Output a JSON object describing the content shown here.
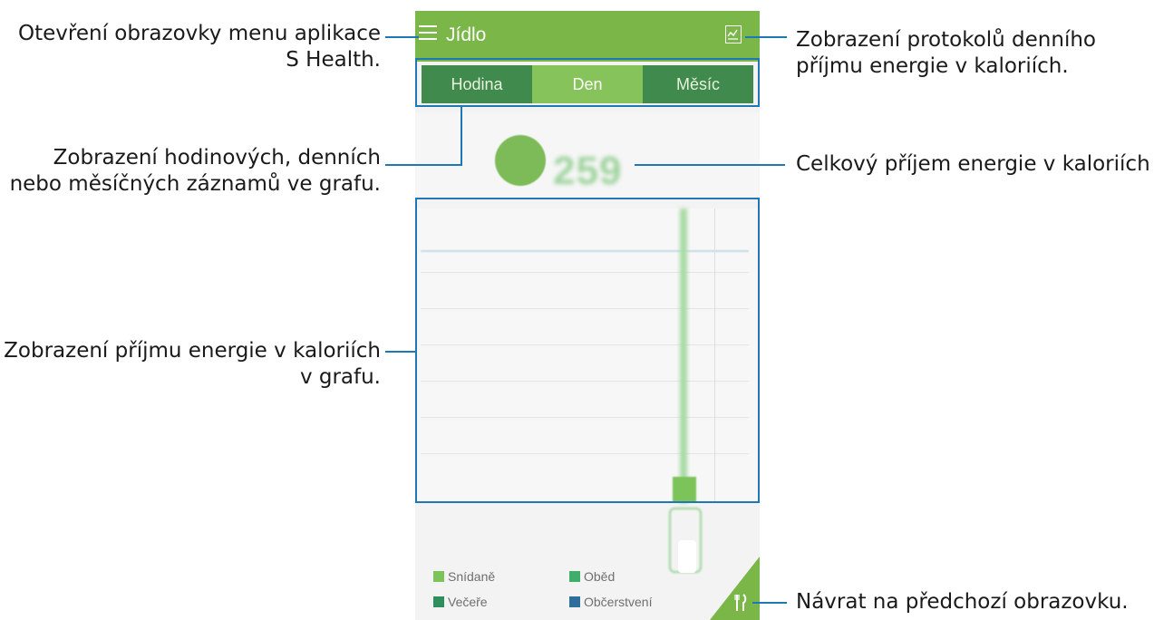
{
  "app": {
    "title": "Jídlo"
  },
  "tabs": [
    {
      "label": "Hodina",
      "selected": false
    },
    {
      "label": "Den",
      "selected": true
    },
    {
      "label": "Měsíc",
      "selected": false
    }
  ],
  "summary": {
    "kcal": "259"
  },
  "legend": [
    {
      "label": "Snídaně",
      "color": "#7cc45a"
    },
    {
      "label": "Oběd",
      "color": "#3fae6a"
    },
    {
      "label": "Večeře",
      "color": "#2e8f5c"
    },
    {
      "label": "Občerstvení",
      "color": "#2e6e9a"
    }
  ],
  "annotations": {
    "menu": [
      "Otevření obrazovky menu aplikace",
      "S Health."
    ],
    "logs": [
      "Zobrazení protokolů denního",
      "příjmu energie v kaloriích."
    ],
    "tabs": [
      "Zobrazení hodinových, denních",
      "nebo měsíčných záznamů ve grafu."
    ],
    "total": [
      "Celkový příjem energie v kaloriích"
    ],
    "graph": [
      "Zobrazení příjmu energie v kaloriích",
      "v grafu."
    ],
    "back": [
      "Návrat na předchozí obrazovku."
    ]
  },
  "colors": {
    "accent": "#7ab648",
    "tab_dark": "#3f8a4c",
    "tab_selected": "#86c35a",
    "annotation_line": "#1e78b4"
  },
  "icons": {
    "menu": "hamburger-menu-icon",
    "logs": "chart-log-icon",
    "back": "fork-knife-icon"
  }
}
